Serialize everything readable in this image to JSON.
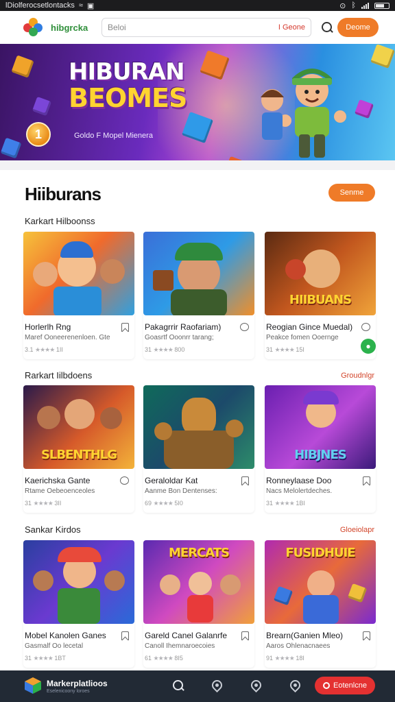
{
  "status_bar": {
    "left_text": "lDiolferocsetlontacks",
    "right_icons": [
      "alarm-icon",
      "bluetooth-icon",
      "signal-icon",
      "battery-icon"
    ]
  },
  "header": {
    "brand": "hibgrcka",
    "search_placeholder": "Beloi",
    "search_tag": "I Geone",
    "action_label": "Deome",
    "accent": "#ef7b28"
  },
  "banner": {
    "title_line1": "HIBURAN",
    "title_line2": "BEOMES",
    "caption": "Goldo F Mopel Mienera",
    "coin_label": "1"
  },
  "main": {
    "title": "Hiiburans",
    "title_button": "Senme",
    "sections": [
      {
        "heading": "Karkart Hilboonss",
        "link": "",
        "cards": [
          {
            "title": "Horlerlh Rng",
            "sub": "Maref Ooneerenenloen. Gte",
            "rating": "3.1",
            "stars": "★★★★",
            "reviews": "1II",
            "icon": "bookmark-icon"
          },
          {
            "title": "Pakagrrir Raofariam)",
            "sub": "Goasrtf Ooonrr tarang;",
            "rating": "31",
            "stars": "★★★★",
            "reviews": "800",
            "icon": "chat-icon"
          },
          {
            "title": "Reogian Gince Muedal)",
            "sub": "Peakce fomen Ooernge",
            "rating": "31",
            "stars": "★★★★",
            "reviews": "15I",
            "icon": "chat-icon"
          }
        ]
      },
      {
        "heading": "Rarkart Iilbdoens",
        "link": "Groudnlgr",
        "cards": [
          {
            "title": "Kaerichska Gante",
            "sub": "Rtame Oebeoenceoles",
            "rating": "31",
            "stars": "★★★★",
            "reviews": "3II",
            "icon": "chat-icon"
          },
          {
            "title": "Geraloldar Kat",
            "sub": "Aanme Bon Dentenses:",
            "rating": "69",
            "stars": "★★★★",
            "reviews": "5I0",
            "icon": "bookmark-icon"
          },
          {
            "title": "Ronneylaase Doo",
            "sub": "Nacs Melolertdeches.",
            "rating": "31",
            "stars": "★★★★",
            "reviews": "1BI",
            "icon": "bookmark-icon"
          }
        ]
      },
      {
        "heading": "Sankar Kirdos",
        "link": "Gloeiolapr",
        "cards": [
          {
            "title": "Mobel Kanolen Ganes",
            "sub": "Gasmalf Oo lecetal",
            "rating": "31",
            "stars": "★★★★",
            "reviews": "1BT",
            "icon": "bookmark-icon"
          },
          {
            "title": "Gareld Canel Galanrfe",
            "sub": "Canoll Ihemnaroecoies",
            "rating": "61",
            "stars": "★★★★",
            "reviews": "8I5",
            "icon": "bookmark-icon"
          },
          {
            "title": "Brearn(Ganien Mleo)",
            "sub": "Aaros Ohlenacnaees",
            "rating": "91",
            "stars": "★★★★",
            "reviews": "18I",
            "icon": "bookmark-icon"
          }
        ]
      }
    ]
  },
  "bottom_nav": {
    "app_name": "Markerplatlioos",
    "app_tag": "Eselenicoony loroes",
    "cta": "Eotenlcne",
    "icons": [
      "search-icon",
      "location-icon",
      "location-icon",
      "location-icon"
    ]
  }
}
